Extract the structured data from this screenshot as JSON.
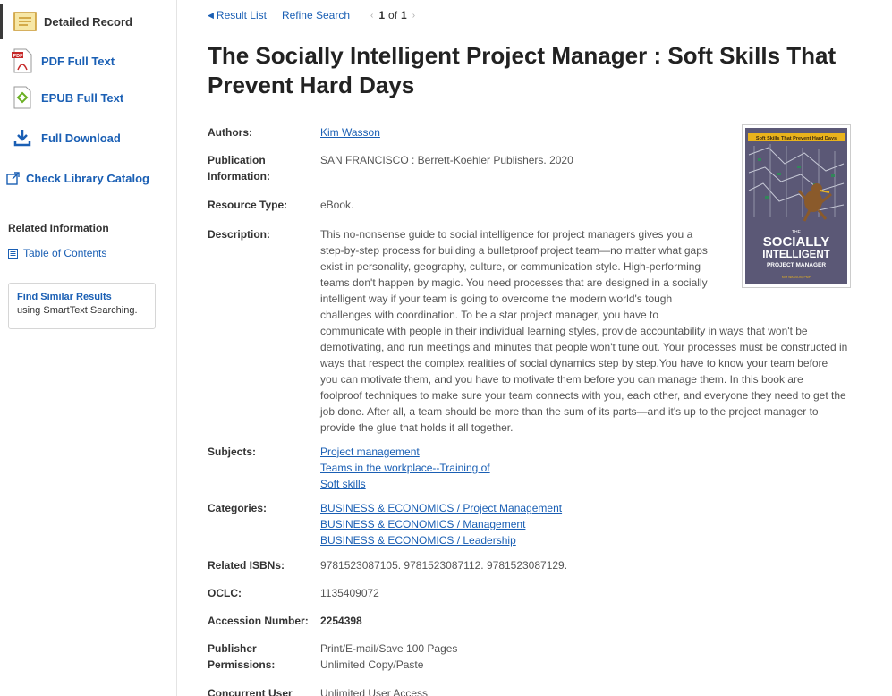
{
  "sidebar": {
    "detailed_record": "Detailed Record",
    "pdf": "PDF Full Text",
    "epub": "EPUB Full Text",
    "download": "Full Download",
    "catalog": "Check Library Catalog",
    "related_heading": "Related Information",
    "toc": "Table of Contents",
    "similar_title": "Find Similar Results",
    "similar_sub": "using SmartText Searching."
  },
  "topnav": {
    "result_list": "Result List",
    "refine": "Refine Search",
    "page_current": "1",
    "page_of": "of",
    "page_total": "1"
  },
  "record": {
    "title": "The Socially Intelligent Project Manager : Soft Skills That Prevent Hard Days",
    "authors_label": "Authors:",
    "author": "Kim Wasson",
    "pubinfo_label_1": "Publication",
    "pubinfo_label_2": "Information:",
    "pubinfo": "SAN FRANCISCO : Berrett-Koehler Publishers. 2020",
    "resource_label": "Resource Type:",
    "resource": "eBook.",
    "description_label": "Description:",
    "description_lines_narrow": [
      "This no-nonsense guide to social intelligence for project managers gives you a",
      "step-by-step process for building a bulletproof project team—no matter what gaps",
      "exist in personality, geography, culture, or communication style. High-performing",
      "teams don't happen by magic. You need processes that are designed in a socially",
      "intelligent way if your team is going to overcome the modern world's tough",
      "challenges with coordination. To be a star project manager, you have to"
    ],
    "description_lines_wide": [
      "communicate with people in their individual learning styles, provide accountability in ways that won't be",
      "demotivating, and run meetings and minutes that people won't tune out. Your processes must be constructed in",
      "ways that respect the complex realities of social dynamics step by step.You have to know your team before",
      "you can motivate them, and you have to motivate them before you can manage them. In this book are",
      "foolproof techniques to make sure your team connects with you, each other, and everyone they need to get the",
      "job done. After all, a team should be more than the sum of its parts—and it's up to the project manager to",
      "provide the glue that holds it all together."
    ],
    "subjects_label": "Subjects:",
    "subjects": [
      "Project management",
      "Teams in the workplace--Training of",
      "Soft skills"
    ],
    "categories_label": "Categories:",
    "categories": [
      "BUSINESS & ECONOMICS / Project Management",
      "BUSINESS & ECONOMICS / Management",
      "BUSINESS & ECONOMICS / Leadership"
    ],
    "isbn_label": "Related ISBNs:",
    "isbns": "9781523087105. 9781523087112. 9781523087129.",
    "oclc_label": "OCLC:",
    "oclc": "1135409072",
    "accession_label": "Accession Number:",
    "accession": "2254398",
    "permissions_label_1": "Publisher",
    "permissions_label_2": "Permissions:",
    "permissions_1": "Print/E-mail/Save 100 Pages",
    "permissions_2": "Unlimited Copy/Paste",
    "concurrent_label": "Concurrent User",
    "concurrent": "Unlimited User Access"
  },
  "cover": {
    "banner": "Soft Skills That Prevent Hard Days",
    "the": "THE",
    "line1": "SOCIALLY",
    "line2": "INTELLIGENT",
    "line3": "PROJECT MANAGER",
    "author": "KIM WASSON, PMP",
    "colors": {
      "background": "#5b5876",
      "banner": "#e9b31c",
      "text": "#ffffff"
    }
  }
}
